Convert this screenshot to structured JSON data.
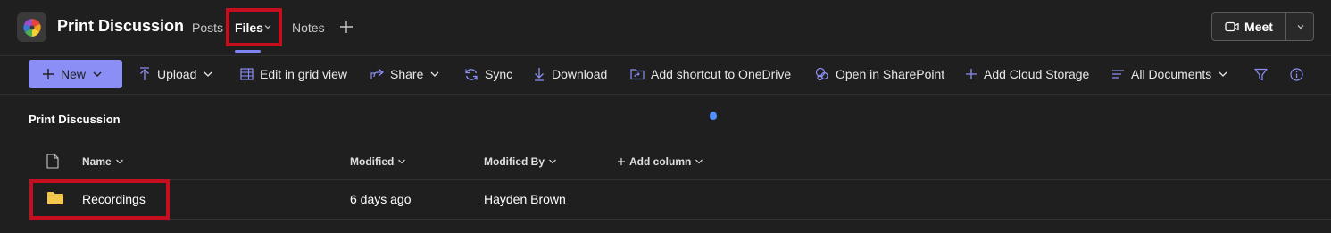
{
  "header": {
    "team_title": "Print Discussion",
    "tabs": [
      {
        "label": "Posts",
        "active": false
      },
      {
        "label": "Files",
        "active": true
      },
      {
        "label": "Notes",
        "active": false
      }
    ],
    "meet_label": "Meet"
  },
  "commands": {
    "new": "New",
    "upload": "Upload",
    "edit_grid": "Edit in grid view",
    "share": "Share",
    "sync": "Sync",
    "download": "Download",
    "add_shortcut": "Add shortcut to OneDrive",
    "open_sharepoint": "Open in SharePoint",
    "add_cloud": "Add Cloud Storage",
    "view": "All Documents"
  },
  "library": {
    "title": "Print Discussion",
    "columns": {
      "name": "Name",
      "modified": "Modified",
      "modified_by": "Modified By",
      "add_column": "Add column"
    },
    "rows": [
      {
        "name": "Recordings",
        "type": "folder",
        "modified": "6 days ago",
        "modified_by": "Hayden Brown"
      }
    ]
  },
  "colors": {
    "background": "#1f1f1f",
    "accent": "#7f85f5",
    "new_button": "#8b8ff5",
    "highlight": "#c50f1f",
    "folder": "#f2c94c"
  }
}
